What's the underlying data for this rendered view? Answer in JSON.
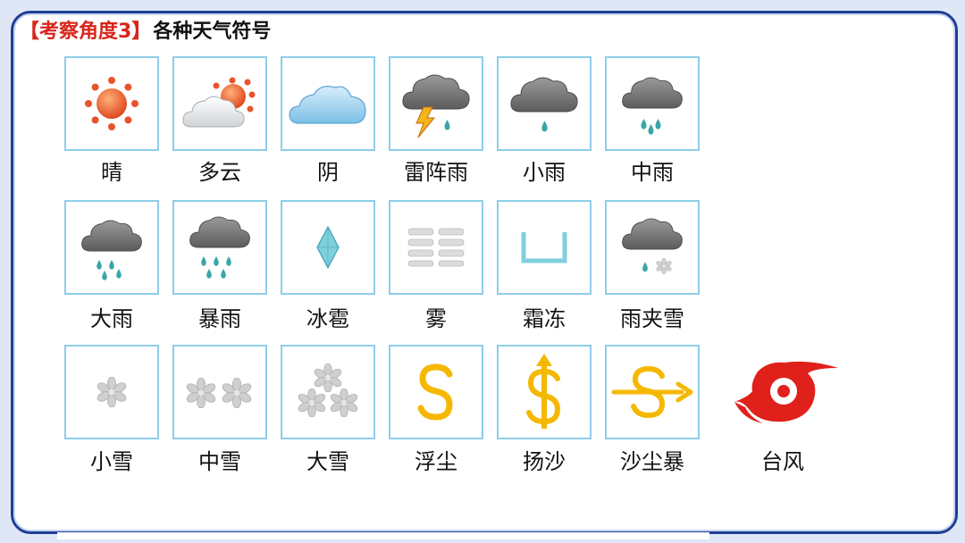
{
  "heading": {
    "tag": "【考察角度3】",
    "title": "各种天气符号"
  },
  "symbols": [
    {
      "label": "晴",
      "icon": "sun-icon"
    },
    {
      "label": "多云",
      "icon": "partly-cloudy-icon"
    },
    {
      "label": "阴",
      "icon": "overcast-cloud-icon"
    },
    {
      "label": "雷阵雨",
      "icon": "thunderstorm-icon"
    },
    {
      "label": "小雨",
      "icon": "light-rain-icon"
    },
    {
      "label": "中雨",
      "icon": "moderate-rain-icon"
    },
    {
      "label": "大雨",
      "icon": "heavy-rain-icon"
    },
    {
      "label": "暴雨",
      "icon": "rainstorm-icon"
    },
    {
      "label": "冰雹",
      "icon": "hail-icon"
    },
    {
      "label": "雾",
      "icon": "fog-icon"
    },
    {
      "label": "霜冻",
      "icon": "frost-icon"
    },
    {
      "label": "雨夹雪",
      "icon": "sleet-icon"
    },
    {
      "label": "小雪",
      "icon": "light-snow-icon"
    },
    {
      "label": "中雪",
      "icon": "moderate-snow-icon"
    },
    {
      "label": "大雪",
      "icon": "heavy-snow-icon"
    },
    {
      "label": "浮尘",
      "icon": "floating-dust-icon"
    },
    {
      "label": "扬沙",
      "icon": "blowing-sand-icon"
    },
    {
      "label": "沙尘暴",
      "icon": "sandstorm-icon"
    },
    {
      "label": "台风",
      "icon": "typhoon-icon"
    }
  ],
  "colors": {
    "frame": "#1f3f94",
    "tag": "#d9261c",
    "cell_border": "#8fcdea",
    "sun": "#e8542a",
    "dust": "#f5b800",
    "typhoon": "#e0211b"
  }
}
